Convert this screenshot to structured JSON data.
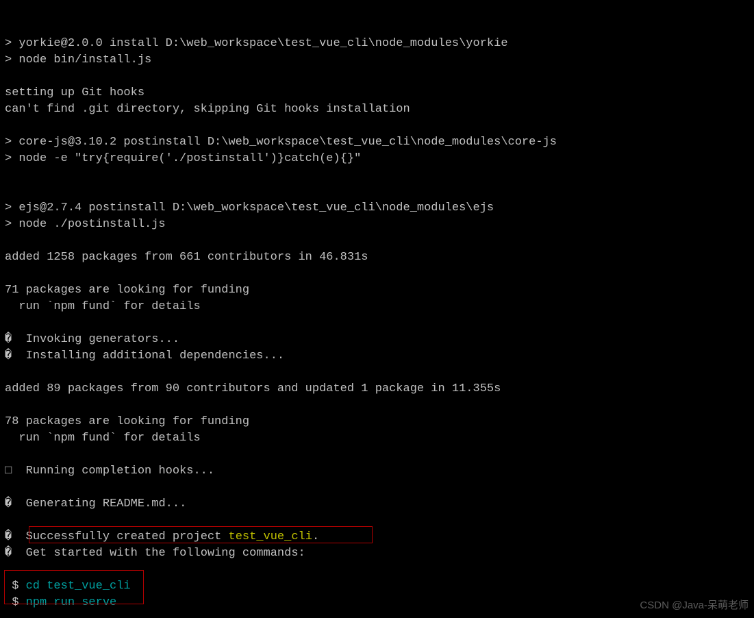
{
  "terminal": {
    "lines": [
      {
        "segs": [
          {
            "t": "> yorkie@2.0.0 install D:\\web_workspace\\test_vue_cli\\node_modules\\yorkie"
          }
        ]
      },
      {
        "segs": [
          {
            "t": "> node bin/install.js"
          }
        ]
      },
      {
        "segs": [
          {
            "t": ""
          }
        ]
      },
      {
        "segs": [
          {
            "t": "setting up Git hooks"
          }
        ]
      },
      {
        "segs": [
          {
            "t": "can't find .git directory, skipping Git hooks installation"
          }
        ]
      },
      {
        "segs": [
          {
            "t": ""
          }
        ]
      },
      {
        "segs": [
          {
            "t": "> core-js@3.10.2 postinstall D:\\web_workspace\\test_vue_cli\\node_modules\\core-js"
          }
        ]
      },
      {
        "segs": [
          {
            "t": "> node -e \"try{require('./postinstall')}catch(e){}\""
          }
        ]
      },
      {
        "segs": [
          {
            "t": ""
          }
        ]
      },
      {
        "segs": [
          {
            "t": ""
          }
        ]
      },
      {
        "segs": [
          {
            "t": "> ejs@2.7.4 postinstall D:\\web_workspace\\test_vue_cli\\node_modules\\ejs"
          }
        ]
      },
      {
        "segs": [
          {
            "t": "> node ./postinstall.js"
          }
        ]
      },
      {
        "segs": [
          {
            "t": ""
          }
        ]
      },
      {
        "segs": [
          {
            "t": "added 1258 packages from 661 contributors in 46.831s"
          }
        ]
      },
      {
        "segs": [
          {
            "t": ""
          }
        ]
      },
      {
        "segs": [
          {
            "t": "71 packages are looking for funding"
          }
        ]
      },
      {
        "segs": [
          {
            "t": "  run `npm fund` for details"
          }
        ]
      },
      {
        "segs": [
          {
            "t": ""
          }
        ]
      },
      {
        "segs": [
          {
            "t": "�"
          },
          {
            "t": "  Invoking generators..."
          }
        ]
      },
      {
        "segs": [
          {
            "t": "�"
          },
          {
            "t": "  Installing additional dependencies..."
          }
        ]
      },
      {
        "segs": [
          {
            "t": ""
          }
        ]
      },
      {
        "segs": [
          {
            "t": "added 89 packages from 90 contributors and updated 1 package in 11.355s"
          }
        ]
      },
      {
        "segs": [
          {
            "t": ""
          }
        ]
      },
      {
        "segs": [
          {
            "t": "78 packages are looking for funding"
          }
        ]
      },
      {
        "segs": [
          {
            "t": "  run `npm fund` for details"
          }
        ]
      },
      {
        "segs": [
          {
            "t": ""
          }
        ]
      },
      {
        "segs": [
          {
            "t": "□"
          },
          {
            "t": "  Running completion hooks..."
          }
        ]
      },
      {
        "segs": [
          {
            "t": ""
          }
        ]
      },
      {
        "segs": [
          {
            "t": "�"
          },
          {
            "t": "  Generating README.md..."
          }
        ]
      },
      {
        "segs": [
          {
            "t": ""
          }
        ]
      },
      {
        "segs": [
          {
            "t": "�"
          },
          {
            "t": "  Successfully created project "
          },
          {
            "t": "test_vue_cli",
            "cls": "yellow"
          },
          {
            "t": "."
          }
        ]
      },
      {
        "segs": [
          {
            "t": "�"
          },
          {
            "t": "  Get started with the following commands:"
          }
        ]
      },
      {
        "segs": [
          {
            "t": ""
          }
        ]
      },
      {
        "segs": [
          {
            "t": " $",
            "cls": "bullet"
          },
          {
            "t": " cd test_vue_cli",
            "cls": "cyan"
          }
        ]
      },
      {
        "segs": [
          {
            "t": " $",
            "cls": "bullet"
          },
          {
            "t": " npm run serve",
            "cls": "cyan"
          }
        ]
      }
    ]
  },
  "watermark": "CSDN @Java-呆萌老师"
}
